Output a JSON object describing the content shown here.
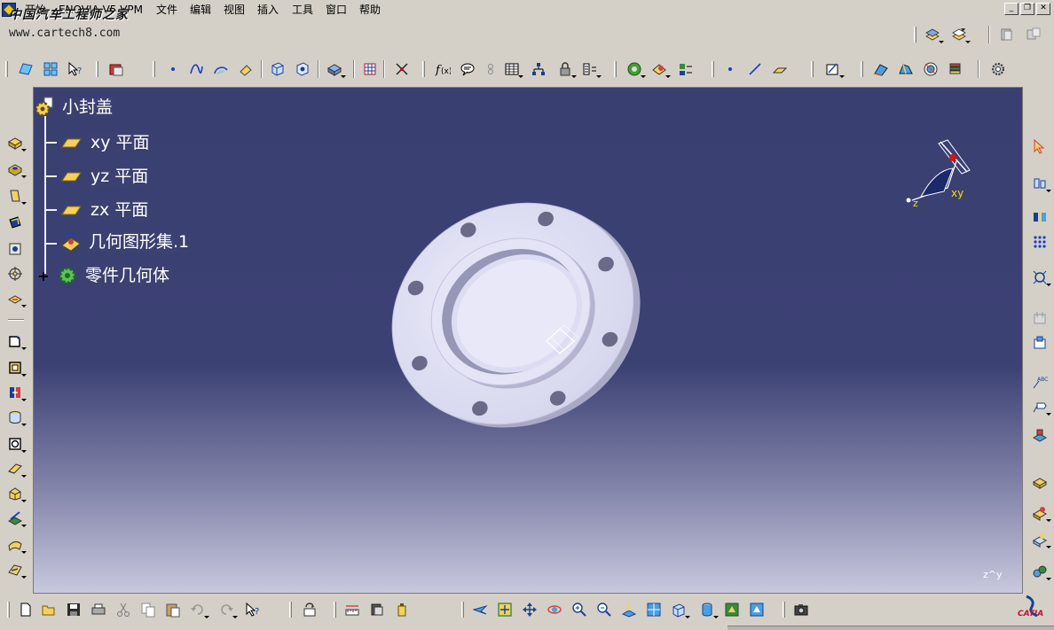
{
  "menubar": {
    "items": [
      "开始",
      "ENOVIA V5 VPM",
      "文件",
      "编辑",
      "视图",
      "插入",
      "工具",
      "窗口",
      "帮助"
    ]
  },
  "watermark": {
    "chinese": "中国汽车工程师之家",
    "url": "www.cartech8.com"
  },
  "spec_tree": {
    "root": "小封盖",
    "children": [
      "xy 平面",
      "yz 平面",
      "zx 平面",
      "几何图形集.1",
      "零件几何体"
    ]
  },
  "compass": {
    "plane_label": "xy",
    "axis_label": "z"
  },
  "view_axis_label": "z^y",
  "branding": {
    "logo_text": "CATIA",
    "logo_mark": "3S"
  },
  "colors": {
    "viewport_top": "#3a3f72",
    "viewport_bottom": "#c8c8de",
    "part_face": "#e4e4f6",
    "tree_text": "#ffffff",
    "compass_accent": "#f5e000",
    "compass_handle": "#e01010"
  },
  "icons": {
    "top_toolbar": [
      "sketch-plane-icon",
      "multi-view-icon",
      "whats-this-icon",
      "catalog-icon",
      "point-icon",
      "spline-icon",
      "circle-arc-icon",
      "eraser-icon",
      "front-view-icon",
      "back-view-icon",
      "render-icon",
      "grid-icon",
      "snap-icon",
      "formula-icon",
      "comment-icon",
      "link-icon",
      "table-icon",
      "hierarchy-icon",
      "lock-icon",
      "parameter-icon",
      "tools-palette-icon",
      "analysis-icon",
      "part-info-icon",
      "line-point-icon",
      "line-icon",
      "plane-icon",
      "sketcher-icon",
      "surface-icon",
      "join-icon",
      "boundary-icon",
      "layer-icon",
      "settings-gear-icon"
    ],
    "left_toolbar": [
      "pad-icon",
      "pocket-icon",
      "shaft-icon",
      "groove-icon",
      "hole-icon",
      "rib-icon",
      "slot-icon",
      "edge-fillet-icon",
      "chamfer-icon",
      "draft-icon",
      "shell-icon",
      "thickness-icon",
      "thread-icon",
      "remove-face-icon",
      "split-icon",
      "thick-surface-icon",
      "close-surface-icon",
      "sew-surface-icon"
    ],
    "right_toolbar": [
      "select-arrow-icon",
      "measure-icon",
      "mirror-icon",
      "pattern-icon",
      "scale-icon",
      "constraint-icon",
      "annotation-icon",
      "text-icon",
      "flag-icon",
      "boolean-add-icon",
      "boolean-remove-icon",
      "intersect-icon",
      "union-trim-icon",
      "assemble-icon"
    ],
    "bottom_toolbar": [
      "new-file-icon",
      "open-folder-icon",
      "save-icon",
      "print-icon",
      "cut-icon",
      "copy-icon",
      "paste-icon",
      "undo-icon",
      "redo-icon",
      "whats-this-icon",
      "update-icon",
      "measure-between-icon",
      "measure-item-icon",
      "mass-icon",
      "fly-mode-icon",
      "fit-all-icon",
      "pan-icon",
      "rotate-icon",
      "zoom-in-icon",
      "zoom-out-icon",
      "normal-view-icon",
      "multi-view-icon",
      "iso-view-icon",
      "shading-icon",
      "hide-show-icon",
      "swap-visible-icon",
      "capture-icon"
    ]
  }
}
